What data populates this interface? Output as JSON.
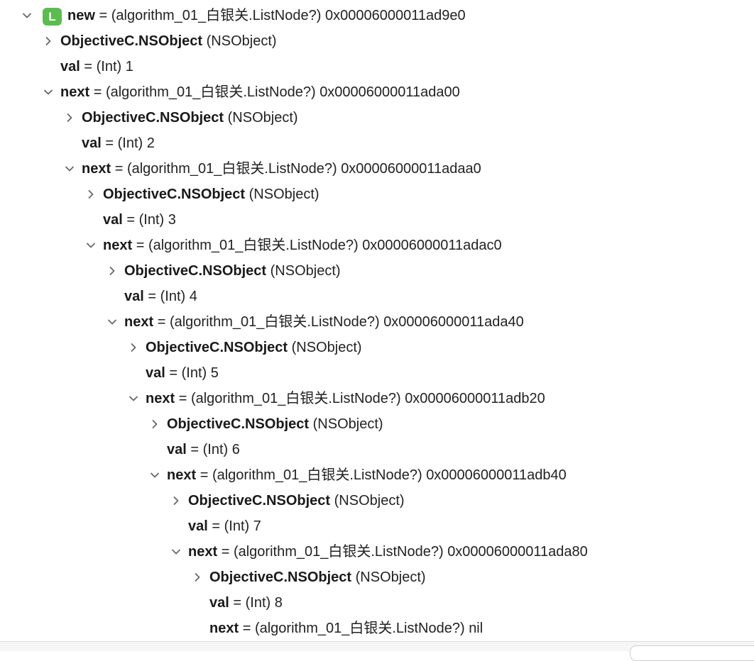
{
  "root": {
    "badge": "L",
    "name": "new",
    "type": "(algorithm_01_白银关.ListNode?)",
    "value": "0x00006000011ad9e0",
    "expanded": true
  },
  "rows": [
    {
      "depth": 1,
      "disc": "closed",
      "name": "ObjectiveC.NSObject",
      "type": "(NSObject)",
      "value": ""
    },
    {
      "depth": 1,
      "disc": "none",
      "name": "val",
      "type": "(Int)",
      "value": "1"
    },
    {
      "depth": 1,
      "disc": "open",
      "name": "next",
      "type": "(algorithm_01_白银关.ListNode?)",
      "value": "0x00006000011ada00"
    },
    {
      "depth": 2,
      "disc": "closed",
      "name": "ObjectiveC.NSObject",
      "type": "(NSObject)",
      "value": ""
    },
    {
      "depth": 2,
      "disc": "none",
      "name": "val",
      "type": "(Int)",
      "value": "2"
    },
    {
      "depth": 2,
      "disc": "open",
      "name": "next",
      "type": "(algorithm_01_白银关.ListNode?)",
      "value": "0x00006000011adaa0"
    },
    {
      "depth": 3,
      "disc": "closed",
      "name": "ObjectiveC.NSObject",
      "type": "(NSObject)",
      "value": ""
    },
    {
      "depth": 3,
      "disc": "none",
      "name": "val",
      "type": "(Int)",
      "value": "3"
    },
    {
      "depth": 3,
      "disc": "open",
      "name": "next",
      "type": "(algorithm_01_白银关.ListNode?)",
      "value": "0x00006000011adac0"
    },
    {
      "depth": 4,
      "disc": "closed",
      "name": "ObjectiveC.NSObject",
      "type": "(NSObject)",
      "value": ""
    },
    {
      "depth": 4,
      "disc": "none",
      "name": "val",
      "type": "(Int)",
      "value": "4"
    },
    {
      "depth": 4,
      "disc": "open",
      "name": "next",
      "type": "(algorithm_01_白银关.ListNode?)",
      "value": "0x00006000011ada40"
    },
    {
      "depth": 5,
      "disc": "closed",
      "name": "ObjectiveC.NSObject",
      "type": "(NSObject)",
      "value": ""
    },
    {
      "depth": 5,
      "disc": "none",
      "name": "val",
      "type": "(Int)",
      "value": "5"
    },
    {
      "depth": 5,
      "disc": "open",
      "name": "next",
      "type": "(algorithm_01_白银关.ListNode?)",
      "value": "0x00006000011adb20"
    },
    {
      "depth": 6,
      "disc": "closed",
      "name": "ObjectiveC.NSObject",
      "type": "(NSObject)",
      "value": ""
    },
    {
      "depth": 6,
      "disc": "none",
      "name": "val",
      "type": "(Int)",
      "value": "6"
    },
    {
      "depth": 6,
      "disc": "open",
      "name": "next",
      "type": "(algorithm_01_白银关.ListNode?)",
      "value": "0x00006000011adb40"
    },
    {
      "depth": 7,
      "disc": "closed",
      "name": "ObjectiveC.NSObject",
      "type": "(NSObject)",
      "value": ""
    },
    {
      "depth": 7,
      "disc": "none",
      "name": "val",
      "type": "(Int)",
      "value": "7"
    },
    {
      "depth": 7,
      "disc": "open",
      "name": "next",
      "type": "(algorithm_01_白银关.ListNode?)",
      "value": "0x00006000011ada80"
    },
    {
      "depth": 8,
      "disc": "closed",
      "name": "ObjectiveC.NSObject",
      "type": "(NSObject)",
      "value": ""
    },
    {
      "depth": 8,
      "disc": "none",
      "name": "val",
      "type": "(Int)",
      "value": "8"
    },
    {
      "depth": 8,
      "disc": "none",
      "name": "next",
      "type": "(algorithm_01_白银关.ListNode?)",
      "value": "nil"
    }
  ],
  "equals": "="
}
